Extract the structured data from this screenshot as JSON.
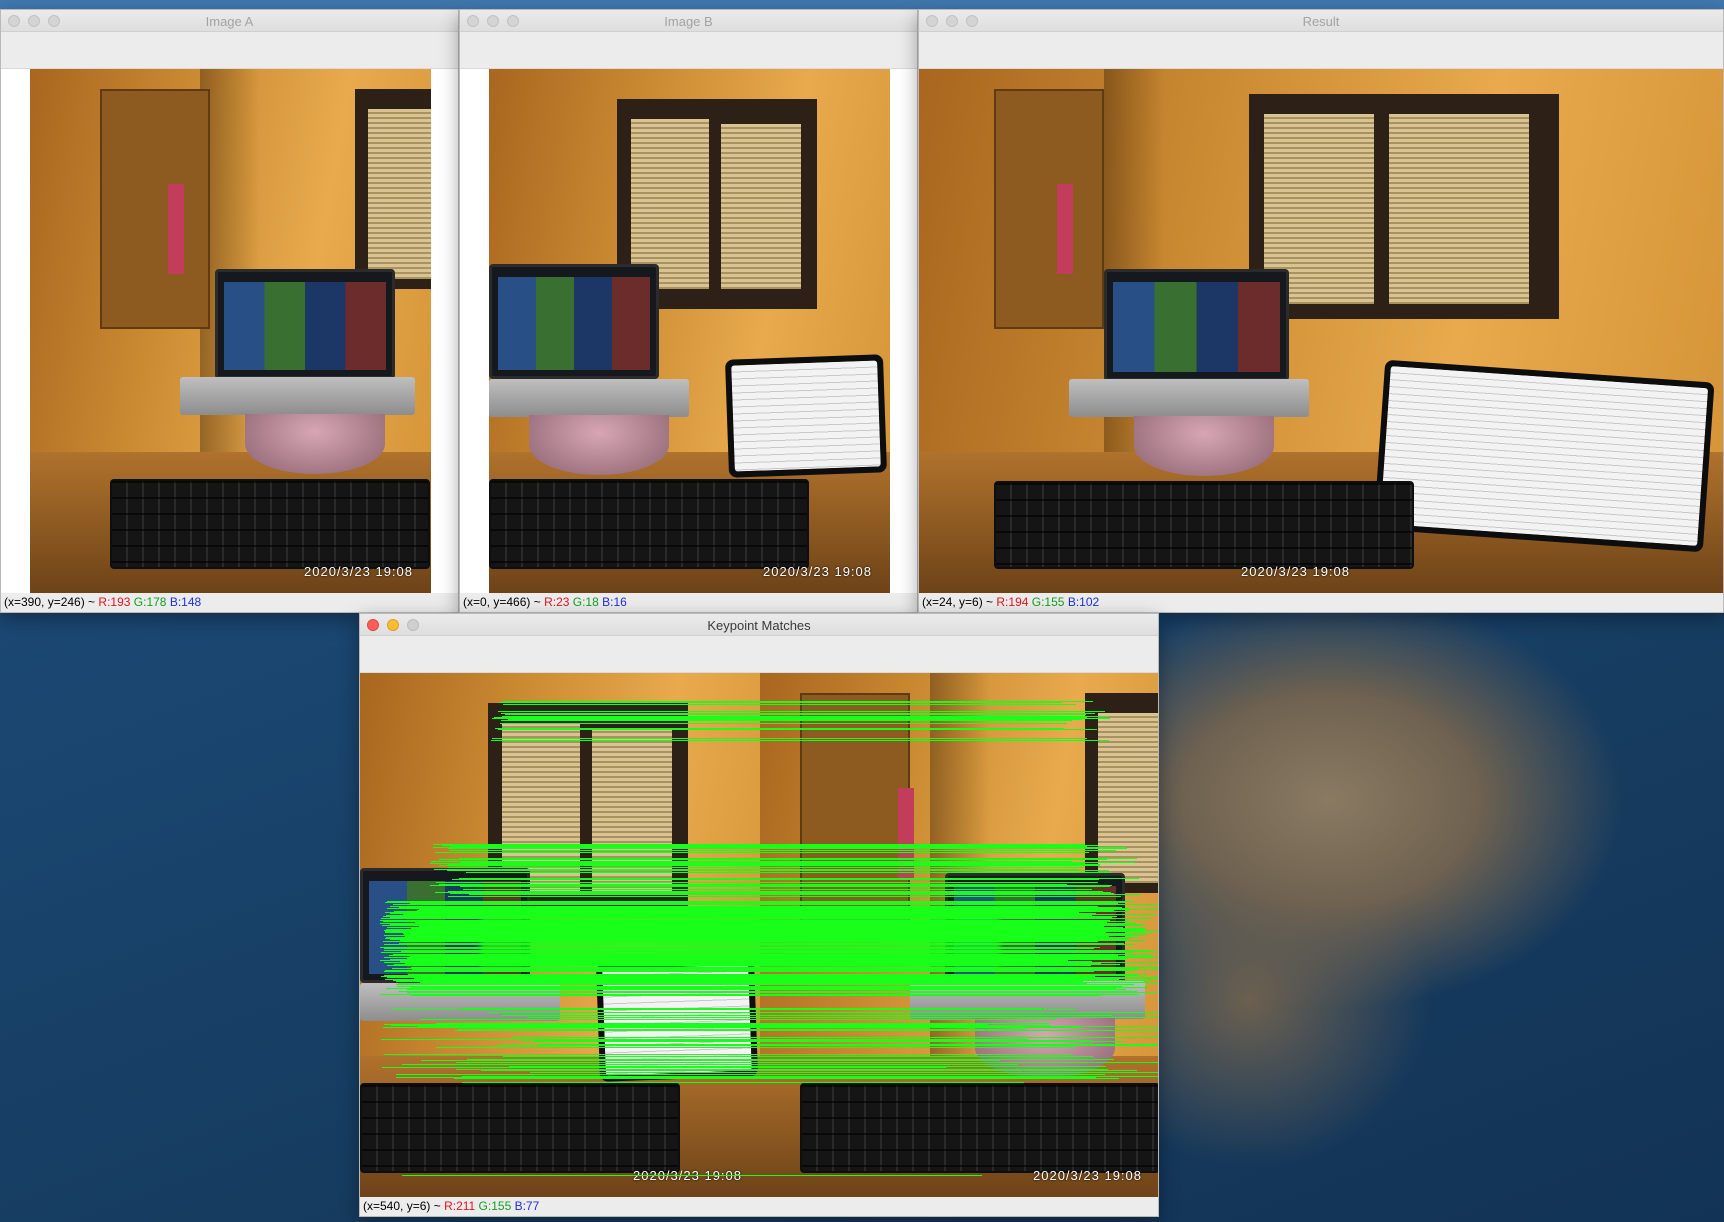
{
  "desktop": {
    "windows": {
      "image_a": {
        "title": "Image A",
        "timestamp": "2020/3/23  19:08",
        "status": {
          "coords": "(x=390, y=246) ~",
          "r": "R:193",
          "g": "G:178",
          "b": "B:148"
        }
      },
      "image_b": {
        "title": "Image B",
        "timestamp": "2020/3/23  19:08",
        "status": {
          "coords": "(x=0, y=466) ~",
          "r": "R:23",
          "g": "G:18",
          "b": "B:16"
        }
      },
      "result": {
        "title": "Result",
        "timestamp": "2020/3/23  19:08",
        "status": {
          "coords": "(x=24, y=6) ~",
          "r": "R:194",
          "g": "G:155",
          "b": "B:102"
        }
      },
      "keypoint_matches": {
        "title": "Keypoint Matches",
        "timestamp_left": "2020/3/23  19:08",
        "timestamp_right": "2020/3/23  19:08",
        "status": {
          "coords": "(x=540, y=6) ~",
          "r": "R:211",
          "g": "G:155",
          "b": "B:77"
        }
      }
    }
  },
  "colors": {
    "match_line": "#18ff1a",
    "status_red": "#e0141e",
    "status_green": "#13a020",
    "status_blue": "#1c2fe0"
  }
}
